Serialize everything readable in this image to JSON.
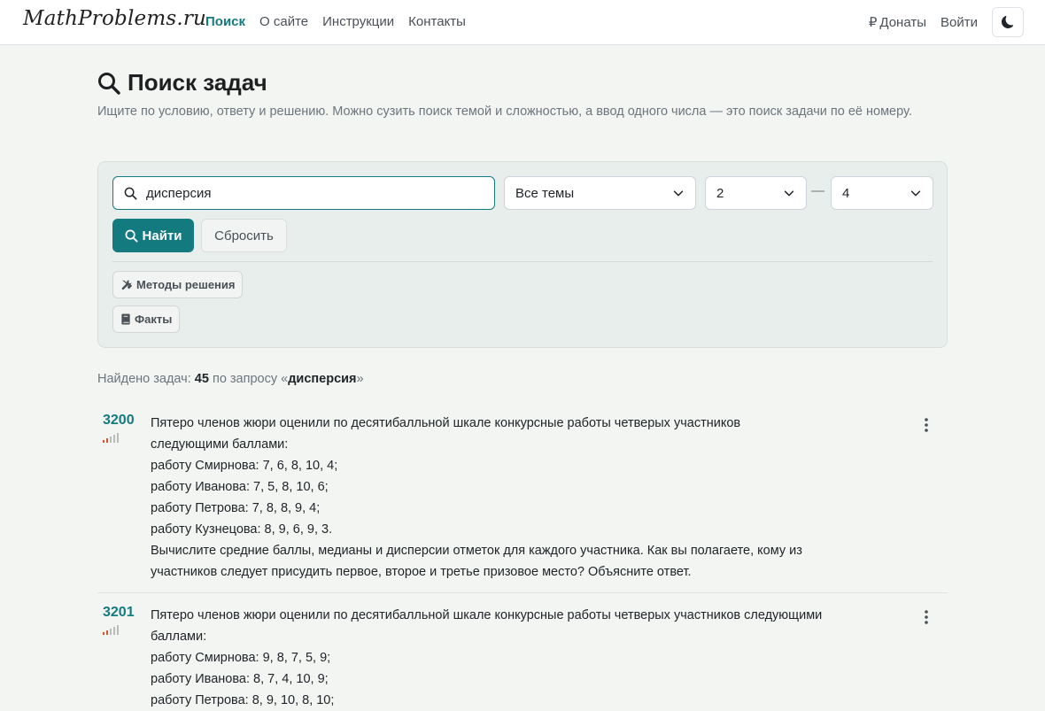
{
  "navbar": {
    "brand": "MathProblems.ru",
    "links": [
      "Поиск",
      "О сайте",
      "Инструкции",
      "Контакты"
    ],
    "donate": "Донаты",
    "donate_symbol": "₽",
    "login": "Войти"
  },
  "header": {
    "title": "Поиск задач",
    "subtitle": "Ищите по условию, ответу и решению. Можно сузить поиск темой и сложностью, а ввод одного числа — это поиск задачи по её номеру."
  },
  "search": {
    "query": "дисперсия",
    "topic": "Все темы",
    "difficulty_from": "2",
    "difficulty_to": "4",
    "range_dash": "—",
    "find_label": "Найти",
    "reset_label": "Сбросить",
    "chips": [
      "Методы решения",
      "Факты"
    ]
  },
  "results": {
    "prefix": "Найдено задач: ",
    "count": "45",
    "middle": " по запросу «",
    "query": "дисперсия",
    "suffix": "»"
  },
  "problems": [
    {
      "number": "3200",
      "lines": [
        "Пятеро членов жюри оценили по десятибалльной шкале конкурсные работы четверых участников",
        "следующими баллами:",
        "работу Смирнова: 7, 6, 8, 10, 4;",
        "работу Иванова: 7, 5, 8, 10, 6;",
        "работу Петрова: 7, 8, 8, 9, 4;",
        "работу Кузнецова: 8, 9, 6, 9, 3.",
        "Вычислите средние баллы, медианы и дисперсии отметок для каждого участника. Как вы полагаете, кому из",
        "участников следует присудить первое, второе и третье призовое место? Объясните ответ."
      ]
    },
    {
      "number": "3201",
      "lines": [
        "Пятеро членов жюри оценили по десятибалльной шкале конкурсные работы четверых участников следующими",
        "баллами:",
        "работу Смирнова: 9, 8, 7, 5, 9;",
        "работу Иванова: 8, 7, 4, 10, 9;",
        "работу Петрова: 8, 9, 10, 8, 10;"
      ]
    }
  ],
  "colors": {
    "accent": "#137a80",
    "difficulty_active": "#d9532c",
    "difficulty_inactive": "#b8bdb9"
  }
}
